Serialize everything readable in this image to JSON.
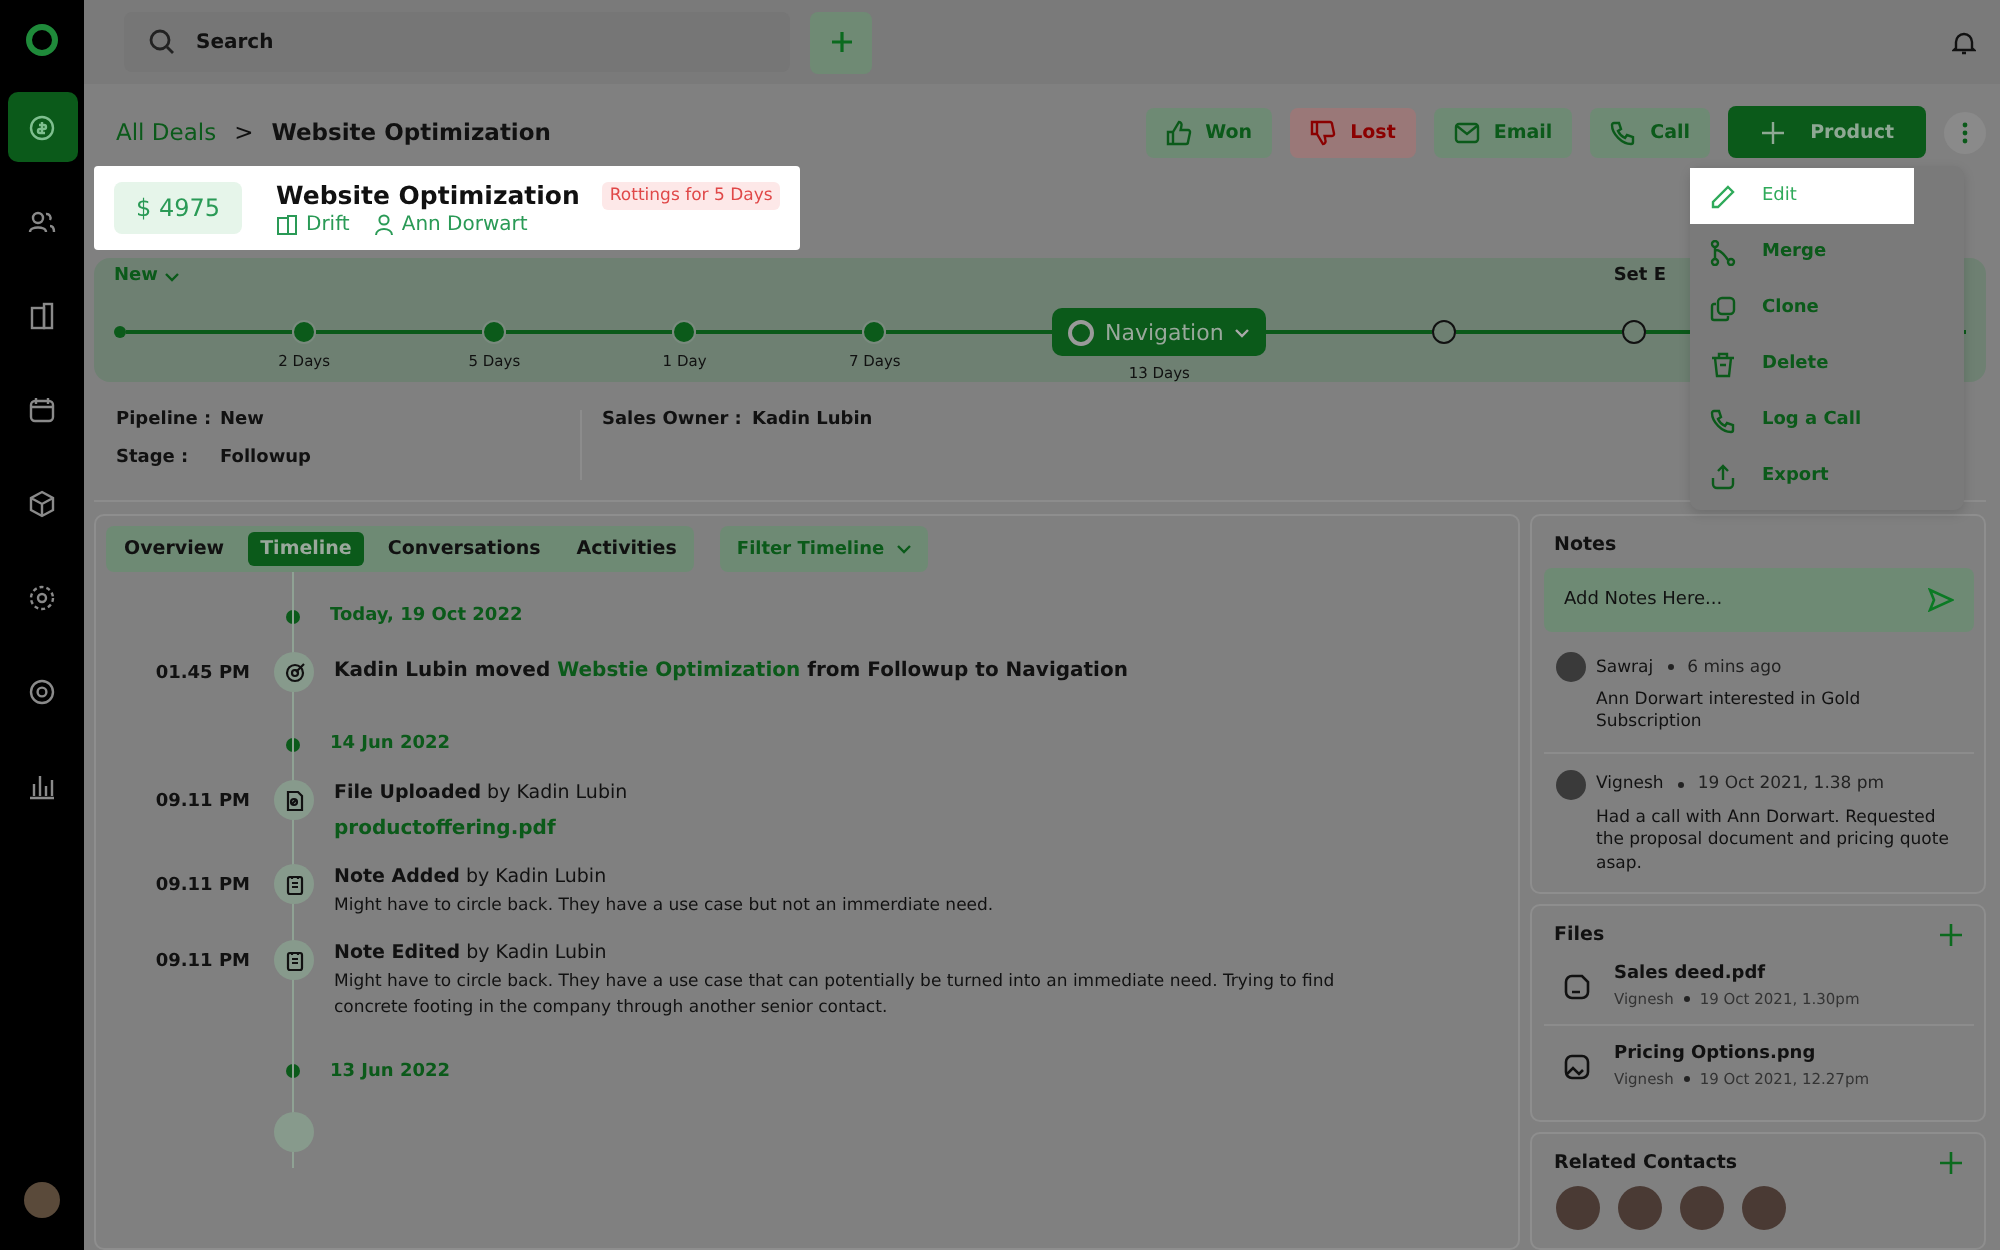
{
  "sidebar": {
    "items": [
      {
        "kind": "deals",
        "selected": true
      },
      {
        "kind": "contacts",
        "selected": false
      },
      {
        "kind": "companies",
        "selected": false
      },
      {
        "kind": "calendar",
        "selected": false
      },
      {
        "kind": "products",
        "selected": false
      },
      {
        "kind": "settings",
        "selected": false
      },
      {
        "kind": "support",
        "selected": false
      },
      {
        "kind": "reports",
        "selected": false
      }
    ]
  },
  "search": {
    "placeholder": "Search"
  },
  "breadcrumb": {
    "parent": "All Deals",
    "separator": ">",
    "current": "Website Optimization"
  },
  "actions": [
    {
      "kind": "won",
      "label": "Won"
    },
    {
      "kind": "lost",
      "label": "Lost"
    },
    {
      "kind": "email",
      "label": "Email"
    },
    {
      "kind": "call",
      "label": "Call"
    },
    {
      "kind": "product",
      "label": "Product"
    }
  ],
  "menu": {
    "items": [
      {
        "kind": "edit",
        "label": "Edit",
        "highlighted": true
      },
      {
        "kind": "merge",
        "label": "Merge",
        "highlighted": false
      },
      {
        "kind": "clone",
        "label": "Clone",
        "highlighted": false
      },
      {
        "kind": "delete",
        "label": "Delete",
        "highlighted": false
      },
      {
        "kind": "call",
        "label": "Log a Call",
        "highlighted": false
      },
      {
        "kind": "export",
        "label": "Export",
        "highlighted": false
      }
    ]
  },
  "deal": {
    "highlighted": true,
    "amount": "$ 4975",
    "title": "Website Optimization",
    "badge": "Rottings for 5 Days",
    "company": "Drift",
    "contact": "Ann Dorwart"
  },
  "pipeline": {
    "stage_menu": "New",
    "end_label": "Set E",
    "stages": [
      {
        "kind": "start"
      },
      {
        "kind": "done",
        "days": "2 Days"
      },
      {
        "kind": "done",
        "days": "5 Days"
      },
      {
        "kind": "done",
        "days": "1 Day"
      },
      {
        "kind": "done",
        "days": "7 Days"
      },
      {
        "kind": "current",
        "name": "Navigation",
        "days": "13 Days"
      },
      {
        "kind": "pending"
      },
      {
        "kind": "pending"
      }
    ]
  },
  "info": {
    "left": [
      {
        "label": "Pipeline :",
        "value": "New"
      },
      {
        "label": "Stage :",
        "value": "Followup"
      }
    ],
    "right": [
      {
        "label": "Sales Owner :",
        "value": "Kadin Lubin"
      }
    ]
  },
  "tabs": [
    {
      "label": "Overview",
      "selected": false
    },
    {
      "label": "Timeline",
      "selected": true
    },
    {
      "label": "Conversations",
      "selected": false
    },
    {
      "label": "Activities",
      "selected": false
    }
  ],
  "filter": {
    "label": "Filter Timeline"
  },
  "timeline": [
    {
      "date": "Today, 19 Oct 2022",
      "events": [
        {
          "kind": "move",
          "time": "01.45 PM",
          "before": "Kadin Lubin moved",
          "link": "Webstie Optimization",
          "after": "from Followup to Navigation"
        }
      ]
    },
    {
      "date": "14 Jun 2022",
      "events": [
        {
          "kind": "file",
          "time": "09.11 PM",
          "title": "**File Uploaded** by Kadin Lubin",
          "link": "productoffering.pdf"
        },
        {
          "kind": "note",
          "time": "09.11 PM",
          "title": "**Note Added** by Kadin Lubin",
          "body": "Might have to circle back. They have a use case but not an immerdiate need."
        },
        {
          "kind": "note",
          "time": "09.11 PM",
          "title": "**Note Edited** by Kadin Lubin",
          "body": "Might have to circle back. They have a use case that can potentially be turned into an immediate need. Trying to find concrete footing in the company through another senior contact."
        }
      ]
    },
    {
      "date": "13 Jun 2022"
    }
  ],
  "notes": {
    "title": "Notes",
    "placeholder": "Add Notes Here...",
    "items": [
      {
        "author": "Sawraj",
        "time": "6 mins ago",
        "text": "Ann Dorwart interested in Gold Subscription"
      },
      {
        "author": "Vignesh",
        "time": "19 Oct 2021, 1.38 pm",
        "text": "Had a call with Ann Dorwart. Requested the proposal document and pricing quote asap."
      }
    ]
  },
  "files": {
    "title": "Files",
    "items": [
      {
        "kind": "document",
        "name": "Sales deed.pdf",
        "author": "Vignesh",
        "time": "19 Oct 2021, 1.30pm"
      },
      {
        "kind": "image",
        "name": "Pricing Options.png",
        "author": "Vignesh",
        "time": "19 Oct 2021, 12.27pm"
      }
    ]
  },
  "contacts": {
    "title": "Related Contacts",
    "items": [
      {
        "kind": "photo"
      },
      {
        "kind": "photo"
      },
      {
        "kind": "photo"
      },
      {
        "kind": "photo"
      }
    ]
  }
}
